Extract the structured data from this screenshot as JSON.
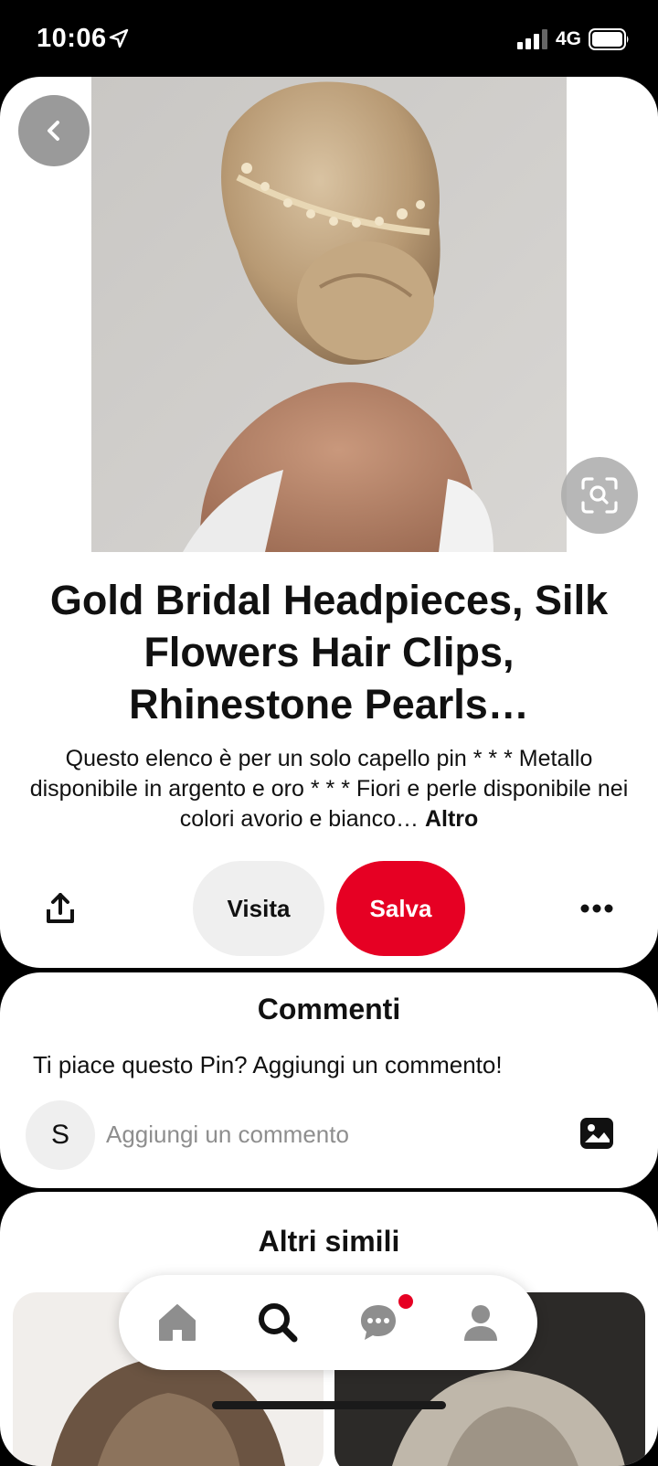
{
  "status_bar": {
    "time": "10:06",
    "network": "4G"
  },
  "pin": {
    "title": "Gold Bridal Headpieces, Silk Flowers Hair Clips, Rhinestone Pearls…",
    "description": "Questo elenco è per un solo capello pin * * * Metallo disponibile in argento e oro * * * Fiori e perle disponibile nei colori avorio e bianco…",
    "more_label": "Altro"
  },
  "actions": {
    "visit_label": "Visita",
    "save_label": "Salva",
    "save_color": "#e60023"
  },
  "comments": {
    "title": "Commenti",
    "prompt": "Ti piace questo Pin? Aggiungi un commento!",
    "avatar_initial": "S",
    "input_placeholder": "Aggiungi un commento"
  },
  "more_like_this": {
    "title": "Altri simili"
  },
  "icons": {
    "back": "chevron-left-icon",
    "lens": "visual-search-icon",
    "share": "share-icon",
    "more": "ellipsis-icon",
    "photo": "image-icon",
    "nav": [
      "home-icon",
      "search-icon",
      "messages-icon",
      "profile-icon"
    ]
  }
}
